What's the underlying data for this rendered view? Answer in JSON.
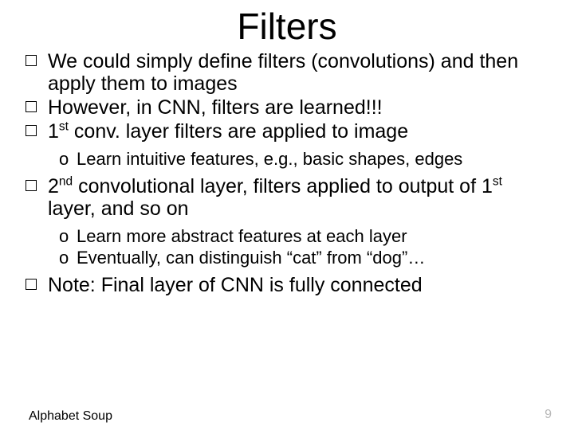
{
  "title": "Filters",
  "bul": {
    "b1": "We could simply define filters (convolutions) and then apply them to images",
    "b2": "However, in CNN, filters are learned!!!",
    "b3_pre": "1",
    "b3_sup": "st",
    "b3_post": " conv. layer filters are applied to image",
    "s1": "Learn intuitive features, e.g., basic shapes, edges",
    "b4_pre": "2",
    "b4_sup": "nd",
    "b4_mid": " convolutional layer, filters applied to output of 1",
    "b4_sup2": "st",
    "b4_post": " layer, and so on",
    "s2": "Learn more abstract features at each layer",
    "s3": "Eventually, can distinguish “cat” from “dog”…",
    "b5": "Note: Final layer of CNN is fully connected"
  },
  "footer": {
    "left": "Alphabet Soup",
    "right": "9"
  }
}
